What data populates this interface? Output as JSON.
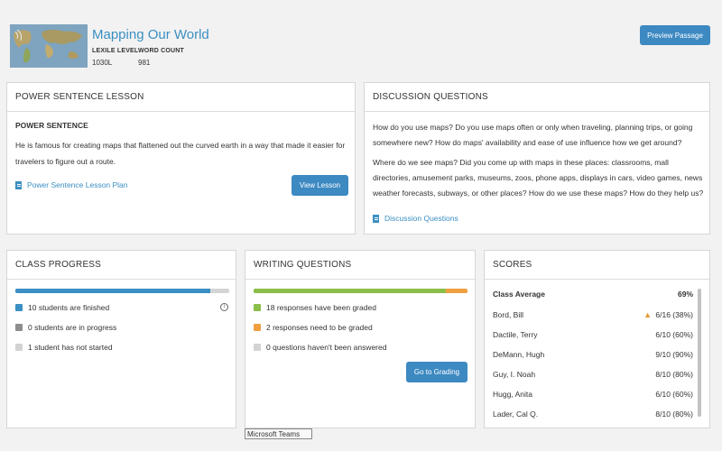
{
  "header": {
    "title": "Mapping Our World",
    "lexile_label": "LEXILE LEVEL",
    "lexile_value": "1030L",
    "word_count_label": "WORD COUNT",
    "word_count_value": "981",
    "preview_button": "Preview Passage"
  },
  "power_sentence": {
    "heading": "POWER SENTENCE LESSON",
    "subheading": "POWER SENTENCE",
    "text": "He is famous for creating maps that flattened out the curved earth in a way that made it easier for travelers to figure out a route.",
    "link": "Power Sentence Lesson Plan",
    "button": "View Lesson"
  },
  "discussion": {
    "heading": "DISCUSSION QUESTIONS",
    "paragraph1": "How do you use maps? Do you use maps often or only when traveling, planning trips, or going somewhere new? How do maps' availability and ease of use influence how we get around?",
    "paragraph2": "Where do we see maps? Did you come up with maps in these places: classrooms, mall directories, amusement parks, museums, zoos, phone apps, displays in cars, video games, news weather forecasts, subways, or other places? How do we use these maps? How do they help us?",
    "link": "Discussion Questions"
  },
  "class_progress": {
    "heading": "CLASS PROGRESS",
    "finished_fraction": 0.91,
    "items": [
      {
        "label": "10 students are finished",
        "color": "#3a8fc4"
      },
      {
        "label": "0 students are in progress",
        "color": "#8d8d8d"
      },
      {
        "label": "1 student has not started",
        "color": "#d3d3d3"
      }
    ]
  },
  "writing": {
    "heading": "WRITING QUESTIONS",
    "graded_fraction": 0.9,
    "items": [
      {
        "label": "18 responses have been graded",
        "color": "#8bbf4a"
      },
      {
        "label": "2 responses need to be graded",
        "color": "#f0a040"
      },
      {
        "label": "0 questions haven't been answered",
        "color": "#d3d3d3"
      }
    ],
    "button": "Go to Grading"
  },
  "scores": {
    "heading": "SCORES",
    "average_label": "Class Average",
    "average_value": "69%",
    "rows": [
      {
        "name": "Bord, Bill",
        "score": "6/16 (38%)"
      },
      {
        "name": "Dactile, Terry",
        "score": "6/10 (60%)"
      },
      {
        "name": "DeMann, Hugh",
        "score": "9/10 (90%)"
      },
      {
        "name": "Guy, I. Noah",
        "score": "8/10 (80%)"
      },
      {
        "name": "Hugg, Anita",
        "score": "6/10 (60%)"
      },
      {
        "name": "Lader, Cal Q.",
        "score": "8/10 (80%)"
      }
    ]
  },
  "tooltip": "Microsoft Teams",
  "colors": {
    "accent": "#3d89c2",
    "warning": "#e39a33"
  }
}
